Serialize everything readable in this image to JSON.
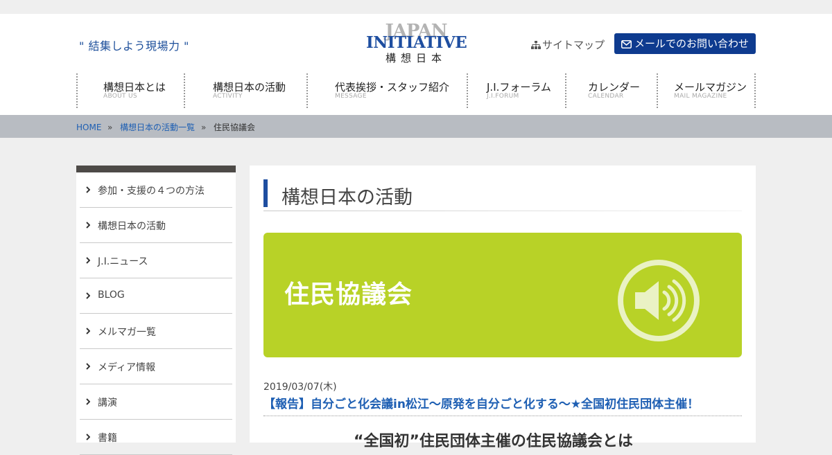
{
  "header": {
    "tagline": "\" 結集しよう現場力 \"",
    "logo": {
      "line1": "JAPAN",
      "line2": "INITIATIVE",
      "line3": "構想日本"
    },
    "sitemap_label": "サイトマップ",
    "sitemap_icon": "sitemap-icon",
    "mail_button_label": "メールでのお問い合わせ",
    "mail_icon": "envelope-icon"
  },
  "nav": [
    {
      "label": "構想日本とは",
      "sub": "ABOUT US"
    },
    {
      "label": "構想日本の活動",
      "sub": "ACTIVITY"
    },
    {
      "label": "代表挨拶・スタッフ紹介",
      "sub": "MESSAGE"
    },
    {
      "label": "J.I.フォーラム",
      "sub": "J.I.FORUM"
    },
    {
      "label": "カレンダー",
      "sub": "CALENDAR"
    },
    {
      "label": "メールマガジン",
      "sub": "MAIL MAGAZINE"
    }
  ],
  "breadcrumb": {
    "items": [
      "HOME",
      "構想日本の活動一覧"
    ],
    "separator": "»",
    "current": "住民協議会"
  },
  "sidebar": {
    "items": [
      "参加・支援の４つの方法",
      "構想日本の活動",
      "J.I.ニュース",
      "BLOG",
      "メルマガ一覧",
      "メディア情報",
      "講演",
      "書籍"
    ]
  },
  "main": {
    "title": "構想日本の活動",
    "banner": {
      "label": "住民協議会",
      "icon": "speaker-icon",
      "color": "#b8d227"
    },
    "post": {
      "date": "2019/03/07(木)",
      "title": "【報告】自分ごと化会議in松江～原発を自分ごと化する～★全国初住民団体主催！",
      "next_heading": "“全国初”住民団体主催の住民協議会とは"
    }
  },
  "colors": {
    "brand": "#1e4ea0",
    "button": "#0e3b8f",
    "link": "#1e5fb3",
    "crumbs_bg": "#b8bcc2"
  }
}
